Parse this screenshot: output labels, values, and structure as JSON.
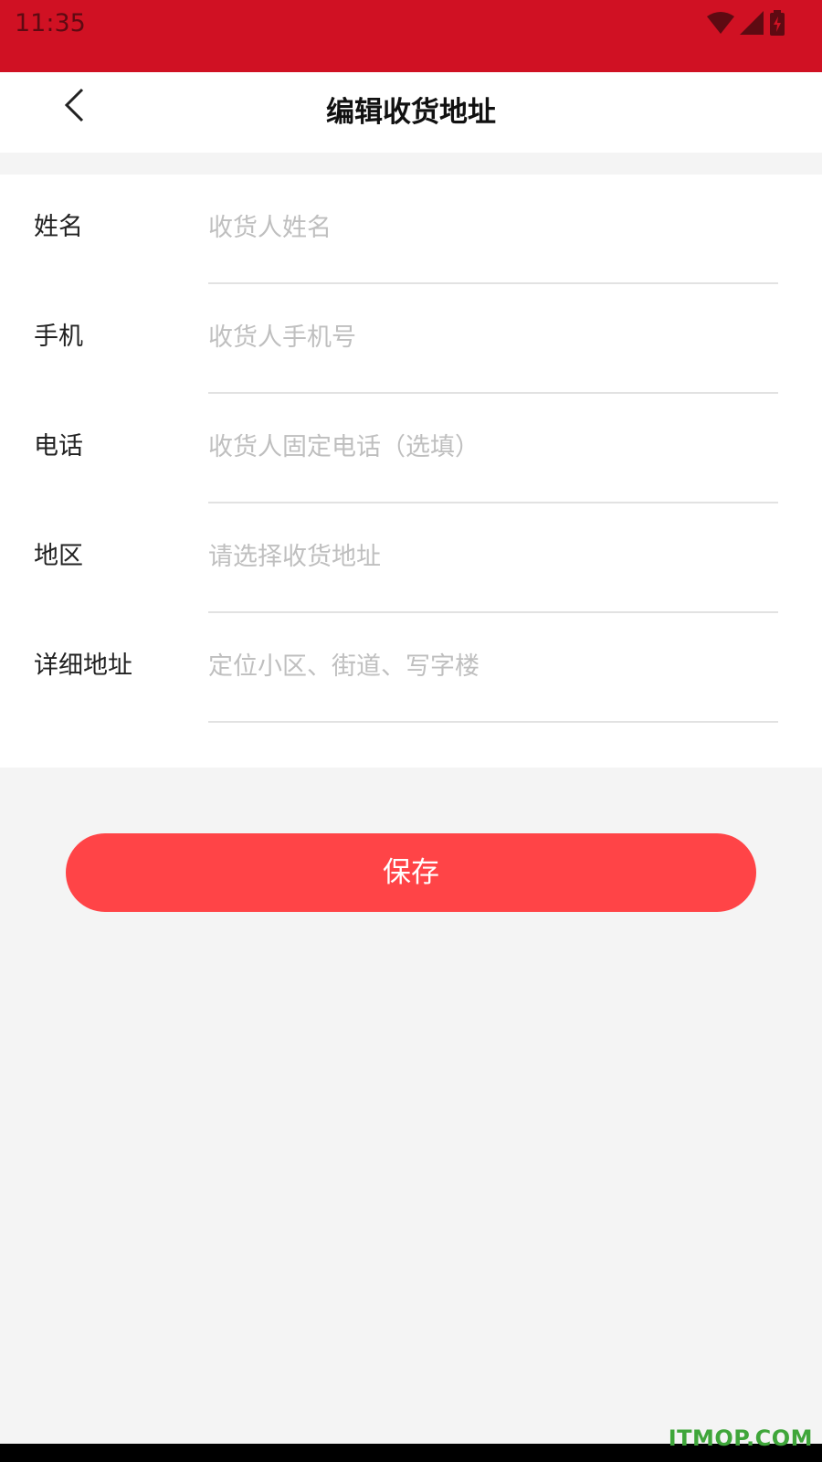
{
  "status_bar": {
    "time": "11:35"
  },
  "header": {
    "title": "编辑收货地址"
  },
  "form": {
    "rows": [
      {
        "label": "姓名",
        "placeholder": "收货人姓名"
      },
      {
        "label": "手机",
        "placeholder": "收货人手机号"
      },
      {
        "label": "电话",
        "placeholder": "收货人固定电话（选填）"
      },
      {
        "label": "地区",
        "placeholder": "请选择收货地址"
      },
      {
        "label": "详细地址",
        "placeholder": "定位小区、街道、写字楼"
      }
    ]
  },
  "save_button": {
    "label": "保存"
  },
  "watermark": "ITMOP.COM",
  "colors": {
    "status_bar": "#d01123",
    "accent": "#ff4447",
    "background": "#f4f4f4"
  }
}
